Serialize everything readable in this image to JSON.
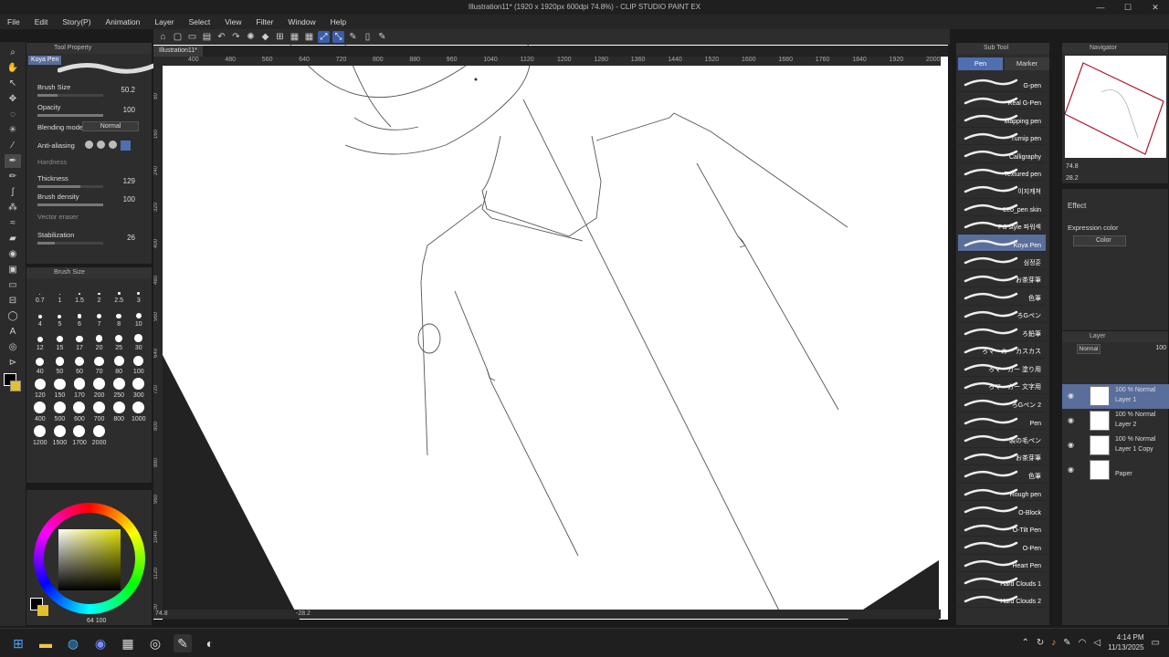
{
  "window": {
    "title": "Illustration11* (1920 x 1920px 600dpi 74.8%) - CLIP STUDIO PAINT EX",
    "controls": [
      "—",
      "☐",
      "✕"
    ]
  },
  "menu": [
    "File",
    "Edit",
    "Story(P)",
    "Animation",
    "Layer",
    "Select",
    "View",
    "Filter",
    "Window",
    "Help"
  ],
  "tool_property": {
    "title": "Tool Property",
    "brush_name": "Koya Pen",
    "brush_size": {
      "label": "Brush Size",
      "value": "50.2",
      "fraction": 0.3
    },
    "opacity": {
      "label": "Opacity",
      "value": "100",
      "fraction": 1.0
    },
    "blending_mode": {
      "label": "Blending mode",
      "value": "Normal"
    },
    "anti_aliasing": {
      "label": "Anti-aliasing"
    },
    "hardness": {
      "label": "Hardness"
    },
    "thickness": {
      "label": "Thickness",
      "value": "129",
      "fraction": 0.65
    },
    "brush_density": {
      "label": "Brush density",
      "value": "100",
      "fraction": 1.0
    },
    "vector_eraser": {
      "label": "Vector eraser"
    },
    "stabilization": {
      "label": "Stabilization",
      "value": "26",
      "fraction": 0.26
    }
  },
  "brush_size_panel": {
    "title": "Brush Size",
    "sizes": [
      "0.7",
      "1",
      "1.5",
      "2",
      "2.5",
      "3",
      "4",
      "5",
      "6",
      "7",
      "8",
      "10",
      "12",
      "15",
      "17",
      "20",
      "25",
      "30",
      "40",
      "50",
      "60",
      "70",
      "80",
      "100",
      "120",
      "150",
      "170",
      "200",
      "250",
      "300",
      "400",
      "500",
      "600",
      "700",
      "800",
      "1000",
      "1200",
      "1500",
      "1700",
      "2000"
    ]
  },
  "color_panel": {
    "main_color": "#000000",
    "sub_color": "#ffffff",
    "readout": "64 100"
  },
  "canvas": {
    "tab": "Illustration11*",
    "ruler_top": [
      "400",
      "480",
      "560",
      "640",
      "720",
      "800",
      "880",
      "960",
      "1040",
      "1120",
      "1200",
      "1280",
      "1360",
      "1440",
      "1520",
      "1600",
      "1680",
      "1760",
      "1840",
      "1920",
      "2000"
    ],
    "ruler_left": [
      "80",
      "160",
      "240",
      "320",
      "400",
      "480",
      "560",
      "640",
      "720",
      "800",
      "880",
      "960",
      "1040",
      "1120",
      "1200"
    ],
    "status_zoom": "74.8",
    "status_angle": "-28.2"
  },
  "sub_tool": {
    "title": "Sub Tool",
    "tabs": [
      "Pen",
      "Marker"
    ],
    "brushes": [
      "G-pen",
      "Real G-Pen",
      "Mapping pen",
      "Turnip pen",
      "Calligraphy",
      "Textured pen",
      "이지캐쳐",
      "Leo_pen skin",
      "PS style 파워섹",
      "Koya Pen",
      "심정훈",
      "お茶芽筆",
      "色筆",
      "ろGペン",
      "ろ鉛筆",
      "ろマーカー カスカス",
      "ろマーカー 塗り用",
      "ろマーカー 文字用",
      "ろGペン 2",
      "Pen",
      "製の毛ペン",
      "お茶芽筆",
      "色筆",
      "Rough pen",
      "O-Block",
      "O-Tilt Pen",
      "O-Pen",
      "Heart Pen",
      "Hard Clouds 1",
      "Hard Clouds 2"
    ],
    "selected": "Koya Pen"
  },
  "navigator": {
    "title": "Navigator",
    "zoom": "74.8",
    "angle": "28.2"
  },
  "effect": {
    "label": "Effect",
    "expression_label": "Expression color",
    "expression_value": "Color"
  },
  "layer_panel": {
    "title": "Layer",
    "blend": "Normal",
    "opacity": "100",
    "layers": [
      {
        "pct": "100 %",
        "mode": "Normal",
        "name": "Layer 1",
        "selected": true
      },
      {
        "pct": "100 %",
        "mode": "Normal",
        "name": "Layer 2",
        "selected": false
      },
      {
        "pct": "100 %",
        "mode": "Normal",
        "name": "Layer 1 Copy",
        "selected": false
      },
      {
        "pct": "",
        "mode": "",
        "name": "Paper",
        "selected": false
      }
    ]
  },
  "taskbar": {
    "time": "4:14 PM",
    "date": "11/13/2025"
  }
}
